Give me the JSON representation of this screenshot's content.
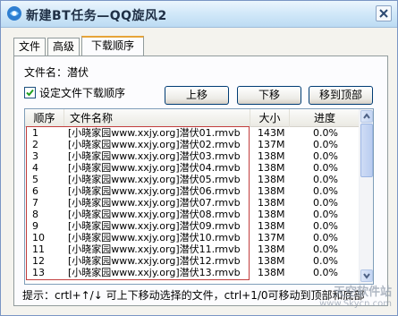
{
  "window": {
    "title": "新建BT任务—QQ旋风2"
  },
  "tabs": [
    {
      "label": "文件",
      "active": false
    },
    {
      "label": "高级",
      "active": false
    },
    {
      "label": "下载顺序",
      "active": true
    }
  ],
  "filename_text": "文件名：潜伏",
  "checkbox": {
    "label": "设定文件下载顺序",
    "checked": true
  },
  "buttons": {
    "up": "上移",
    "down": "下移",
    "top": "移到顶部"
  },
  "table": {
    "columns": [
      "顺序",
      "文件名称",
      "大小",
      "进度"
    ],
    "rows": [
      {
        "order": "1",
        "name": "[小晓家园www.xxjy.org]潜伏01.rmvb",
        "size": "143M",
        "progress": "0.0%"
      },
      {
        "order": "2",
        "name": "[小晓家园www.xxjy.org]潜伏02.rmvb",
        "size": "137M",
        "progress": "0.0%"
      },
      {
        "order": "3",
        "name": "[小晓家园www.xxjy.org]潜伏03.rmvb",
        "size": "138M",
        "progress": "0.0%"
      },
      {
        "order": "4",
        "name": "[小晓家园www.xxjy.org]潜伏04.rmvb",
        "size": "138M",
        "progress": "0.0%"
      },
      {
        "order": "5",
        "name": "[小晓家园www.xxjy.org]潜伏05.rmvb",
        "size": "138M",
        "progress": "0.0%"
      },
      {
        "order": "6",
        "name": "[小晓家园www.xxjy.org]潜伏06.rmvb",
        "size": "138M",
        "progress": "0.0%"
      },
      {
        "order": "7",
        "name": "[小晓家园www.xxjy.org]潜伏07.rmvb",
        "size": "138M",
        "progress": "0.0%"
      },
      {
        "order": "8",
        "name": "[小晓家园www.xxjy.org]潜伏08.rmvb",
        "size": "138M",
        "progress": "0.0%"
      },
      {
        "order": "9",
        "name": "[小晓家园www.xxjy.org]潜伏09.rmvb",
        "size": "138M",
        "progress": "0.0%"
      },
      {
        "order": "10",
        "name": "[小晓家园www.xxjy.org]潜伏10.rmvb",
        "size": "137M",
        "progress": "0.0%"
      },
      {
        "order": "11",
        "name": "[小晓家园www.xxjy.org]潜伏11.rmvb",
        "size": "138M",
        "progress": "0.0%"
      },
      {
        "order": "12",
        "name": "[小晓家园www.xxjy.org]潜伏12.rmvb",
        "size": "138M",
        "progress": "0.0%"
      },
      {
        "order": "13",
        "name": "[小晓家园www.xxjy.org]潜伏13.rmvb",
        "size": "138M",
        "progress": "0.0%"
      }
    ]
  },
  "hint_text": "提示：crtl+↑/↓ 可上下移动选择的文件，ctrl+1/0可移动到顶部和底部",
  "watermark": {
    "main": "天空软件站",
    "sub": "www.Skycn.com"
  },
  "colors": {
    "accent_tab": "#e7a438",
    "highlight_border": "#c23d3d",
    "titlebar": "#d3e9f9"
  }
}
